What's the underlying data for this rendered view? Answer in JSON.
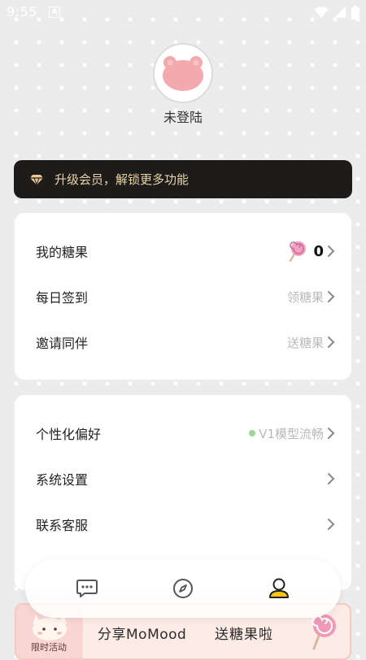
{
  "status_bar": {
    "time": "9:55",
    "notification_icon": "a-icon",
    "icons": [
      "wifi-icon",
      "signal-icon",
      "battery-icon"
    ]
  },
  "profile": {
    "login_status": "未登陆",
    "avatar_icon": "bear-icon"
  },
  "vip_banner": {
    "text": "升级会员，解锁更多功能",
    "icon": "diamond-icon"
  },
  "menu_group_1": [
    {
      "label": "我的糖果",
      "value": "0",
      "icon": "lollipop-icon"
    },
    {
      "label": "每日签到",
      "value": "领糖果"
    },
    {
      "label": "邀请同伴",
      "value": "送糖果"
    }
  ],
  "menu_group_2": [
    {
      "label": "个性化偏好",
      "value": "V1模型流畅"
    },
    {
      "label": "系统设置",
      "value": ""
    },
    {
      "label": "联系客服",
      "value": ""
    }
  ],
  "bottom_nav": {
    "items": [
      "chat-icon",
      "compass-icon",
      "user-icon"
    ],
    "active": "user-icon"
  },
  "promo": {
    "tag": "限时活动",
    "share_text": "分享MoMood",
    "send_text": "送糖果啦"
  },
  "colors": {
    "background": "#ececec",
    "vip_bg": "#1e1b1b",
    "vip_text": "#e9d3a6",
    "promo_bg": "#fdece6",
    "accent_pink": "#f3a9ad",
    "status_green": "#9fd69a"
  }
}
